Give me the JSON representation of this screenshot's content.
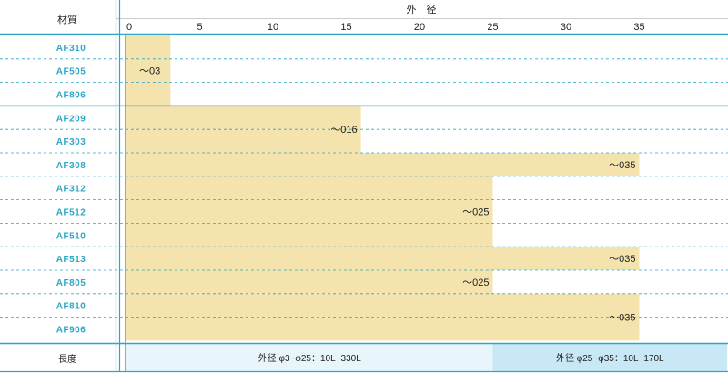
{
  "header": {
    "material_label": "材質",
    "diameter_label": "外　径"
  },
  "chart_data": {
    "type": "bar",
    "orientation": "horizontal",
    "xlabel": "外　径",
    "ylabel": "材質",
    "xlim": [
      0,
      41
    ],
    "xticks": [
      0,
      5,
      10,
      15,
      20,
      25,
      30,
      35
    ],
    "categories": [
      "AF310",
      "AF505",
      "AF806",
      "AF209",
      "AF303",
      "AF308",
      "AF312",
      "AF512",
      "AF510",
      "AF513",
      "AF805",
      "AF810",
      "AF906"
    ],
    "values": [
      3,
      3,
      3,
      16,
      16,
      35,
      25,
      25,
      25,
      35,
      25,
      35,
      35
    ],
    "range_labels": [
      {
        "text": "～03",
        "rows": [
          0,
          2
        ],
        "value": 3
      },
      {
        "text": "～016",
        "rows": [
          3,
          4
        ],
        "value": 16
      },
      {
        "text": "～035",
        "rows": [
          5,
          5
        ],
        "value": 35
      },
      {
        "text": "～025",
        "rows": [
          6,
          8
        ],
        "value": 25
      },
      {
        "text": "～035",
        "rows": [
          9,
          9
        ],
        "value": 35
      },
      {
        "text": "～025",
        "rows": [
          10,
          10
        ],
        "value": 25
      },
      {
        "text": "～035",
        "rows": [
          11,
          12
        ],
        "value": 35
      }
    ],
    "group_breaks_after": [
      2,
      12
    ],
    "bar_color": "#f5e3ad",
    "grid": "dashed-rows"
  },
  "footer": {
    "label": "長度",
    "segments": [
      {
        "text": "外径 φ3~φ25：10L~330L",
        "from": 0,
        "to": 25,
        "color": "#e8f5fb"
      },
      {
        "text": "外径 φ25~φ35：10L~170L",
        "from": 25,
        "to": 41,
        "color": "#c9e8f6"
      }
    ]
  },
  "colors": {
    "rule": "#2fa6c6",
    "material_text": "#2fa6c6",
    "bar": "#f5e3ad"
  }
}
